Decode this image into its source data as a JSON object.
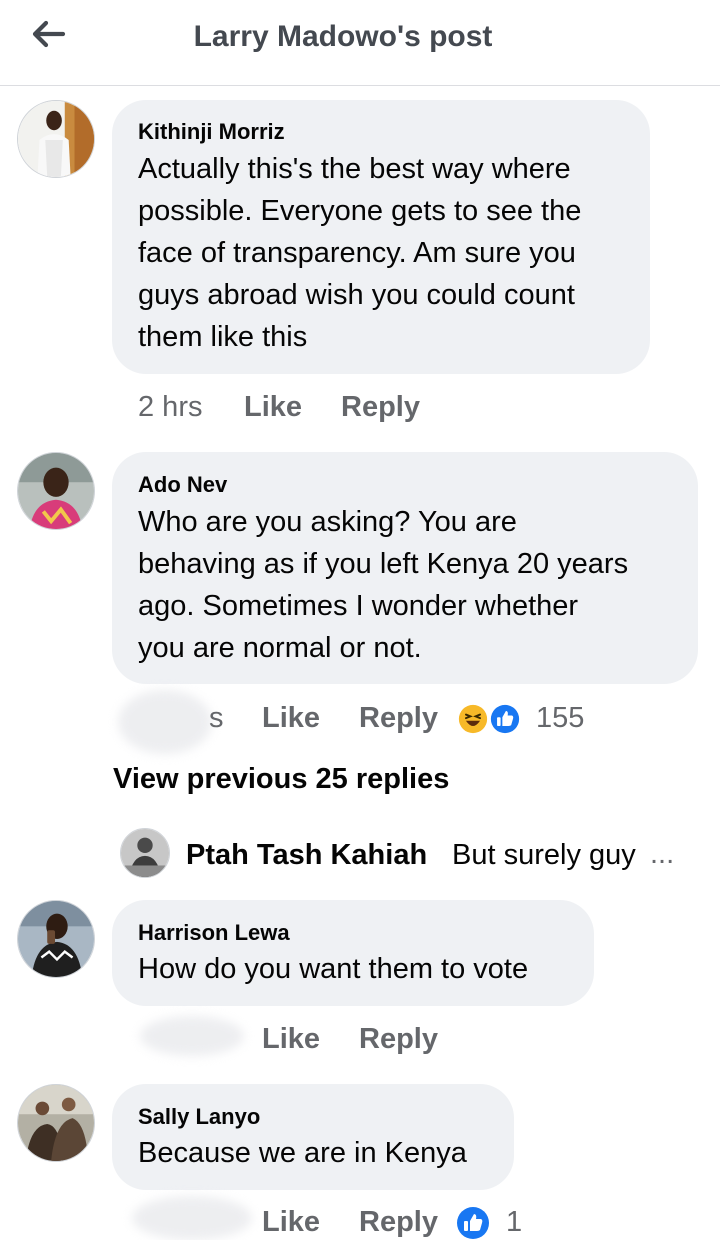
{
  "header": {
    "title": "Larry Madowo's post",
    "back_icon": "arrow-left-icon"
  },
  "comments": [
    {
      "author": "Kithinji Morriz",
      "lines": [
        "Actually this's the best way where",
        "possible. Everyone gets to see the",
        "face of transparency. Am sure you",
        "guys abroad wish you could count",
        "them like this"
      ],
      "time": "2 hrs",
      "like": "Like",
      "reply": "Reply"
    },
    {
      "author": "Ado Nev",
      "lines": [
        "Who are you asking? You are",
        "behaving as if you left Kenya 20 years",
        "ago. Sometimes I wonder whether",
        "you are normal or not."
      ],
      "time": "s",
      "like": "Like",
      "reply": "Reply",
      "reaction_count": "155"
    },
    {
      "author": "Harrison Lewa",
      "lines": [
        "How do you want them to vote"
      ],
      "like": "Like",
      "reply": "Reply"
    },
    {
      "author": "Sally Lanyo",
      "lines": [
        "Because we are in Kenya"
      ],
      "like": "Like",
      "reply": "Reply",
      "reaction_count": "1"
    }
  ],
  "view_previous": "View previous 25 replies",
  "reply_preview": {
    "author": "Ptah Tash Kahiah",
    "text": "But surely guy",
    "ellipsis": "..."
  },
  "colors": {
    "like_blue": "#1877f2",
    "haha_yellow": "#f7b928",
    "bubble": "#eff1f4",
    "meta": "#65676b"
  }
}
